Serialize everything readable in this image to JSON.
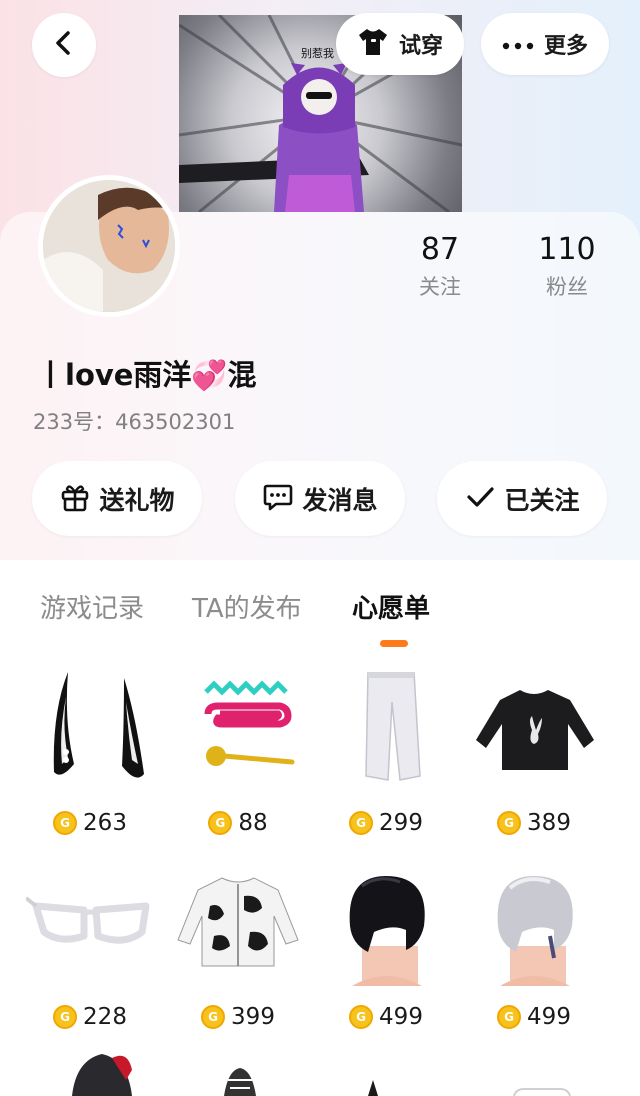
{
  "header": {
    "tryon_label": "试穿",
    "more_label": "更多",
    "banner_caption": "别惹我"
  },
  "profile": {
    "nickname": "丨love雨洋💞混",
    "account": "233号：463502301",
    "following_count": "87",
    "following_label": "关注",
    "followers_count": "110",
    "followers_label": "粉丝"
  },
  "actions": {
    "gift_label": "送礼物",
    "message_label": "发消息",
    "followed_label": "已关注"
  },
  "tabs": [
    {
      "label": "游戏记录",
      "active": false
    },
    {
      "label": "TA的发布",
      "active": false
    },
    {
      "label": "心愿单",
      "active": true
    }
  ],
  "coin_symbol": "G",
  "wishlist": [
    {
      "name": "horns",
      "price": "263"
    },
    {
      "name": "hair-clips",
      "price": "88"
    },
    {
      "name": "white-pants",
      "price": "299"
    },
    {
      "name": "black-sweater",
      "price": "389"
    },
    {
      "name": "white-glasses",
      "price": "228"
    },
    {
      "name": "cow-print-jacket",
      "price": "399"
    },
    {
      "name": "black-hair",
      "price": "499"
    },
    {
      "name": "silver-hair",
      "price": "499"
    }
  ],
  "colors": {
    "accent": "#ff7a1a",
    "coin": "#f6c21b"
  }
}
